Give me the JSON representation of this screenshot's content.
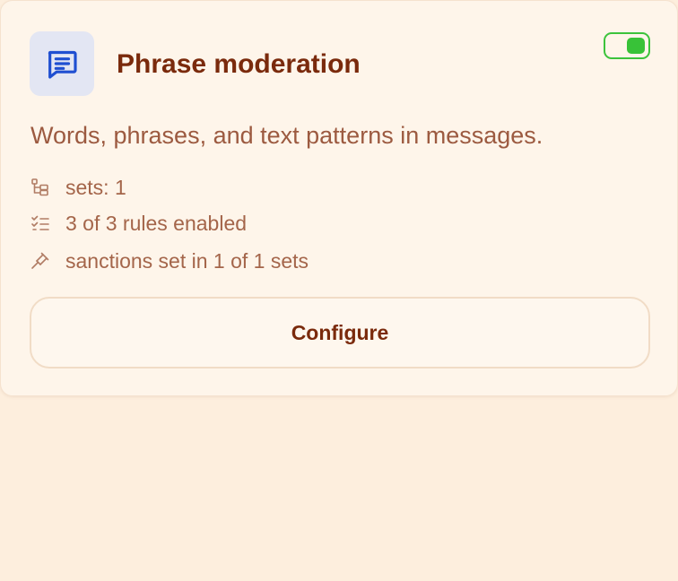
{
  "card": {
    "title": "Phrase moderation",
    "description": "Words, phrases, and text patterns in messages.",
    "enabled": true,
    "icon": "message-text-icon",
    "stats": [
      {
        "icon": "sets-tree-icon",
        "text": "sets: 1"
      },
      {
        "icon": "checklist-icon",
        "text": "3 of 3 rules enabled"
      },
      {
        "icon": "gavel-icon",
        "text": "sanctions set in 1 of 1 sets"
      }
    ],
    "configure_label": "Configure"
  },
  "colors": {
    "page_background": "#fdeedd",
    "card_background": "#fef5ea",
    "title": "#7a2a0c",
    "body_text": "#9c5a40",
    "accent_icon": "#1f4fd1",
    "toggle_on": "#38c238"
  }
}
